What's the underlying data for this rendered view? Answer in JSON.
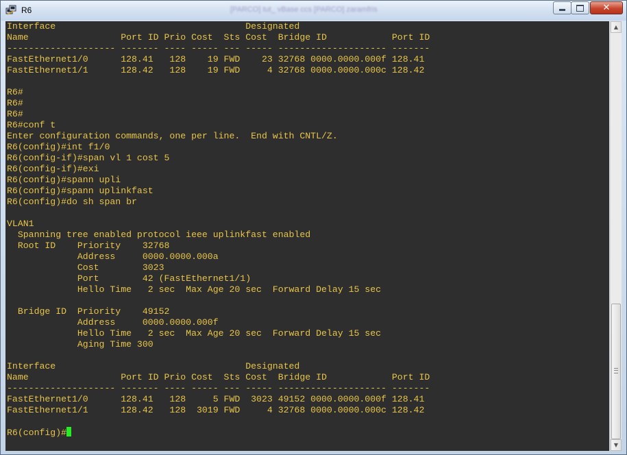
{
  "window": {
    "title": "R6",
    "background_title": "[PARCO] tut_ vBase ccs [PARCO] zaramfris",
    "controls": {
      "minimize": "minimize",
      "maximize": "maximize",
      "close": "✕"
    }
  },
  "colors": {
    "terminal_bg": "#2e2e2e",
    "terminal_fg": "#e8c54a",
    "cursor": "#22ee22"
  },
  "terminal": {
    "lines": [
      "Interface                                   Designated",
      "Name                 Port ID Prio Cost  Sts Cost  Bridge ID            Port ID",
      "-------------------- ------- ---- ----- --- ----- -------------------- -------",
      "FastEthernet1/0      128.41   128    19 FWD    23 32768 0000.0000.000f 128.41",
      "FastEthernet1/1      128.42   128    19 FWD     4 32768 0000.0000.000c 128.42",
      "",
      "R6#",
      "R6#",
      "R6#",
      "R6#conf t",
      "Enter configuration commands, one per line.  End with CNTL/Z.",
      "R6(config)#int f1/0",
      "R6(config-if)#span vl 1 cost 5",
      "R6(config-if)#exi",
      "R6(config)#spann upli",
      "R6(config)#spann uplinkfast",
      "R6(config)#do sh span br",
      "",
      "VLAN1",
      "  Spanning tree enabled protocol ieee uplinkfast enabled",
      "  Root ID    Priority    32768",
      "             Address     0000.0000.000a",
      "             Cost        3023",
      "             Port        42 (FastEthernet1/1)",
      "             Hello Time   2 sec  Max Age 20 sec  Forward Delay 15 sec",
      "",
      "  Bridge ID  Priority    49152",
      "             Address     0000.0000.000f",
      "             Hello Time   2 sec  Max Age 20 sec  Forward Delay 15 sec",
      "             Aging Time 300",
      "",
      "Interface                                   Designated",
      "Name                 Port ID Prio Cost  Sts Cost  Bridge ID            Port ID",
      "-------------------- ------- ---- ----- --- ----- -------------------- -------",
      "FastEthernet1/0      128.41   128     5 FWD  3023 49152 0000.0000.000f 128.41",
      "FastEthernet1/1      128.42   128  3019 FWD     4 32768 0000.0000.000c 128.42",
      ""
    ],
    "prompt": "R6(config)#"
  }
}
